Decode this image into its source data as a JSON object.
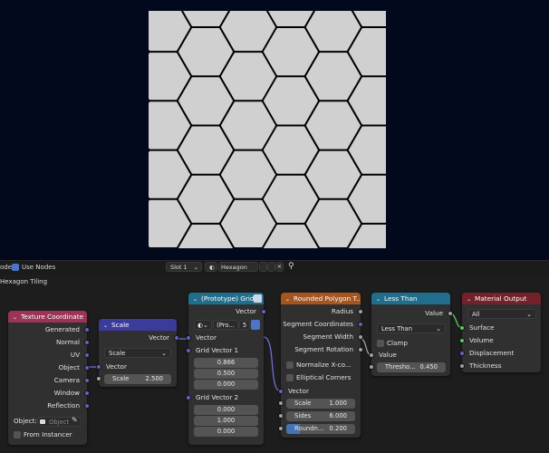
{
  "toolbar": {
    "mode_label": "ode",
    "use_nodes_label": "Use Nodes",
    "slot_label": "Slot 1",
    "material_name": "Hexagon Tiling"
  },
  "breadcrumb": "Hexagon Tiling",
  "nodes": {
    "texcoord": {
      "title": "Texture Coordinate",
      "outputs": [
        "Generated",
        "Normal",
        "UV",
        "Object",
        "Camera",
        "Window",
        "Reflection"
      ],
      "object_label": "Object:",
      "object_placeholder": "Object",
      "from_instancer": "From Instancer"
    },
    "scale": {
      "title": "Scale",
      "output": "Vector",
      "mode": "Scale",
      "input": "Vector",
      "scale_label": "Scale",
      "scale_value": "2.500"
    },
    "grid": {
      "title": "(Prototype) Grid",
      "output": "Vector",
      "dropdown": "(Pro...",
      "count": "5",
      "gv1_label": "Grid Vector 1",
      "gv1": [
        "0.866",
        "0.500",
        "0.000"
      ],
      "gv2_label": "Grid Vector 2",
      "gv2": [
        "0.000",
        "1.000",
        "0.000"
      ]
    },
    "polygon": {
      "title": "Rounded Polygon T...",
      "outputs": [
        "Radius",
        "Segment Coordinates",
        "Segment Width",
        "Segment Rotation"
      ],
      "normalize": "Normalize X-co...",
      "elliptical": "Elliptical Corners",
      "input": "Vector",
      "scale_label": "Scale",
      "scale_value": "1.000",
      "sides_label": "Sides",
      "sides_value": "6.000",
      "round_label": "Roundn...",
      "round_value": "0.200",
      "round_fraction": 0.2
    },
    "lessthan": {
      "title": "Less Than",
      "output": "Value",
      "mode": "Less Than",
      "clamp": "Clamp",
      "input": "Value",
      "thresh_label": "Thresho...",
      "thresh_value": "0.450"
    },
    "matout": {
      "title": "Material Output",
      "target": "All",
      "inputs": [
        "Surface",
        "Volume",
        "Displacement",
        "Thickness"
      ]
    }
  },
  "colors": {
    "texcoord_header": "#9b3458",
    "scale_header": "#3b3b9c",
    "grid_header": "#206e8b",
    "polygon_header": "#a55520",
    "lessthan_header": "#206e8b",
    "matout_header": "#73222c",
    "hex_fill": "#d0d0d0",
    "hex_gap": "#000000"
  }
}
